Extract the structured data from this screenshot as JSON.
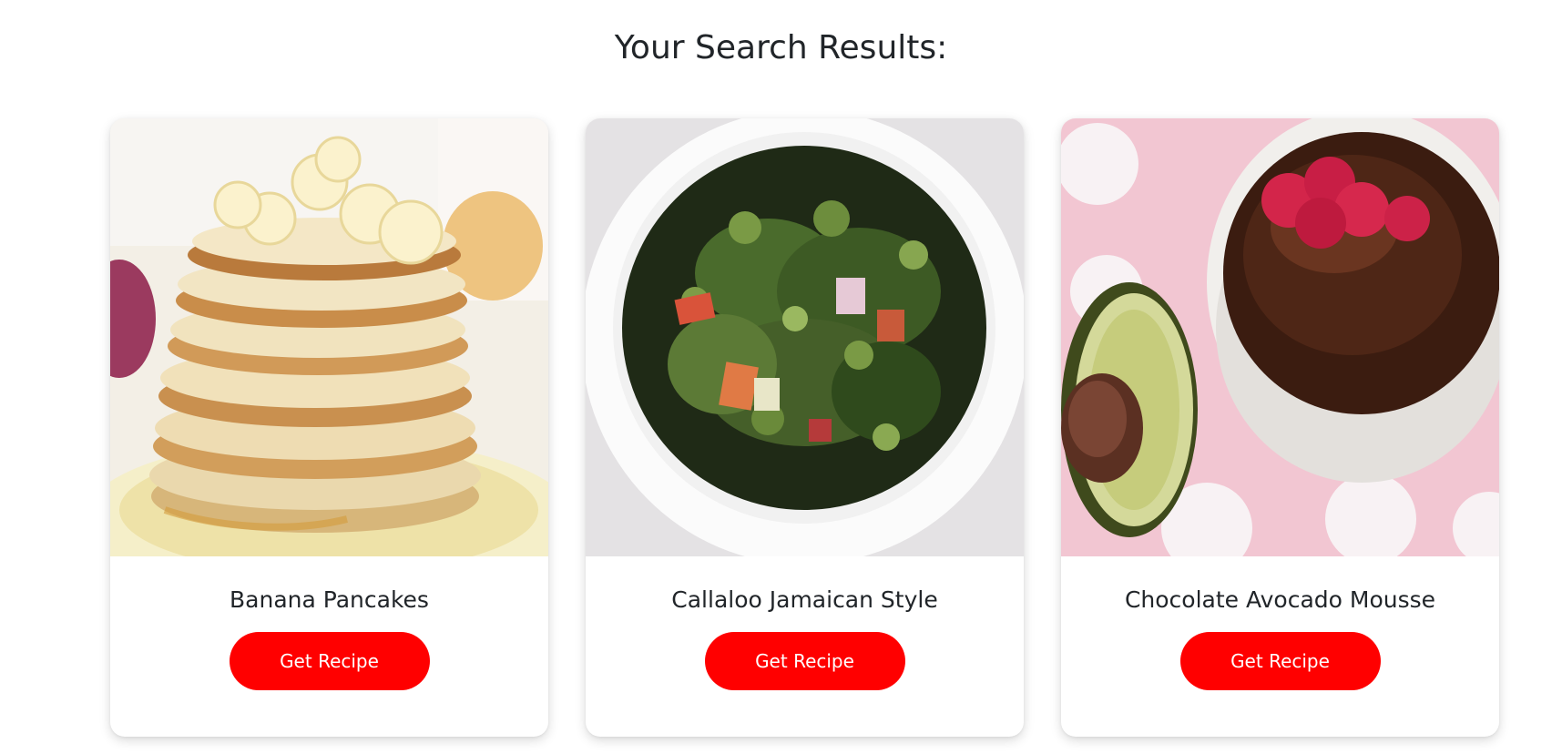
{
  "page": {
    "title": "Your Search Results:"
  },
  "results": [
    {
      "name": "Banana Pancakes",
      "button_label": "Get Recipe",
      "image": "banana-pancakes-photo"
    },
    {
      "name": "Callaloo Jamaican Style",
      "button_label": "Get Recipe",
      "image": "callaloo-photo"
    },
    {
      "name": "Chocolate Avocado Mousse",
      "button_label": "Get Recipe",
      "image": "chocolate-avocado-mousse-photo"
    }
  ],
  "colors": {
    "button_bg": "#ff0000",
    "button_text": "#ffffff",
    "text": "#212529"
  }
}
